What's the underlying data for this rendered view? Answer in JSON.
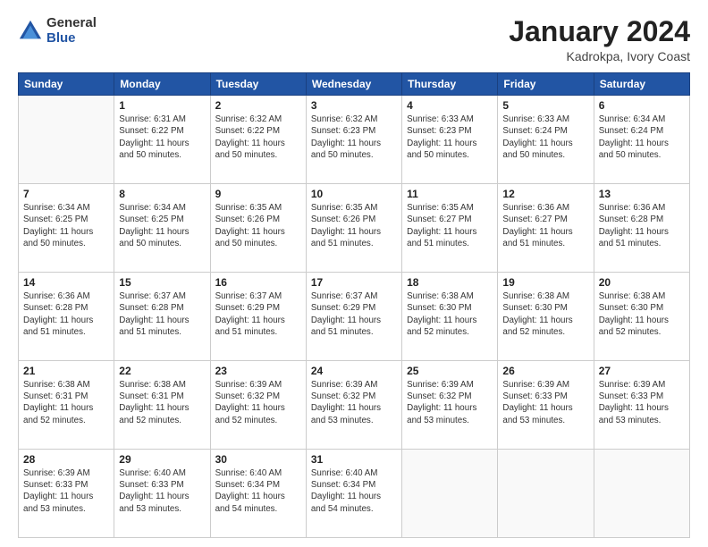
{
  "logo": {
    "general": "General",
    "blue": "Blue"
  },
  "header": {
    "month_year": "January 2024",
    "location": "Kadrokpa, Ivory Coast"
  },
  "days_of_week": [
    "Sunday",
    "Monday",
    "Tuesday",
    "Wednesday",
    "Thursday",
    "Friday",
    "Saturday"
  ],
  "weeks": [
    [
      {
        "day": "",
        "info": ""
      },
      {
        "day": "1",
        "info": "Sunrise: 6:31 AM\nSunset: 6:22 PM\nDaylight: 11 hours\nand 50 minutes."
      },
      {
        "day": "2",
        "info": "Sunrise: 6:32 AM\nSunset: 6:22 PM\nDaylight: 11 hours\nand 50 minutes."
      },
      {
        "day": "3",
        "info": "Sunrise: 6:32 AM\nSunset: 6:23 PM\nDaylight: 11 hours\nand 50 minutes."
      },
      {
        "day": "4",
        "info": "Sunrise: 6:33 AM\nSunset: 6:23 PM\nDaylight: 11 hours\nand 50 minutes."
      },
      {
        "day": "5",
        "info": "Sunrise: 6:33 AM\nSunset: 6:24 PM\nDaylight: 11 hours\nand 50 minutes."
      },
      {
        "day": "6",
        "info": "Sunrise: 6:34 AM\nSunset: 6:24 PM\nDaylight: 11 hours\nand 50 minutes."
      }
    ],
    [
      {
        "day": "7",
        "info": "Sunrise: 6:34 AM\nSunset: 6:25 PM\nDaylight: 11 hours\nand 50 minutes."
      },
      {
        "day": "8",
        "info": "Sunrise: 6:34 AM\nSunset: 6:25 PM\nDaylight: 11 hours\nand 50 minutes."
      },
      {
        "day": "9",
        "info": "Sunrise: 6:35 AM\nSunset: 6:26 PM\nDaylight: 11 hours\nand 50 minutes."
      },
      {
        "day": "10",
        "info": "Sunrise: 6:35 AM\nSunset: 6:26 PM\nDaylight: 11 hours\nand 51 minutes."
      },
      {
        "day": "11",
        "info": "Sunrise: 6:35 AM\nSunset: 6:27 PM\nDaylight: 11 hours\nand 51 minutes."
      },
      {
        "day": "12",
        "info": "Sunrise: 6:36 AM\nSunset: 6:27 PM\nDaylight: 11 hours\nand 51 minutes."
      },
      {
        "day": "13",
        "info": "Sunrise: 6:36 AM\nSunset: 6:28 PM\nDaylight: 11 hours\nand 51 minutes."
      }
    ],
    [
      {
        "day": "14",
        "info": "Sunrise: 6:36 AM\nSunset: 6:28 PM\nDaylight: 11 hours\nand 51 minutes."
      },
      {
        "day": "15",
        "info": "Sunrise: 6:37 AM\nSunset: 6:28 PM\nDaylight: 11 hours\nand 51 minutes."
      },
      {
        "day": "16",
        "info": "Sunrise: 6:37 AM\nSunset: 6:29 PM\nDaylight: 11 hours\nand 51 minutes."
      },
      {
        "day": "17",
        "info": "Sunrise: 6:37 AM\nSunset: 6:29 PM\nDaylight: 11 hours\nand 51 minutes."
      },
      {
        "day": "18",
        "info": "Sunrise: 6:38 AM\nSunset: 6:30 PM\nDaylight: 11 hours\nand 52 minutes."
      },
      {
        "day": "19",
        "info": "Sunrise: 6:38 AM\nSunset: 6:30 PM\nDaylight: 11 hours\nand 52 minutes."
      },
      {
        "day": "20",
        "info": "Sunrise: 6:38 AM\nSunset: 6:30 PM\nDaylight: 11 hours\nand 52 minutes."
      }
    ],
    [
      {
        "day": "21",
        "info": "Sunrise: 6:38 AM\nSunset: 6:31 PM\nDaylight: 11 hours\nand 52 minutes."
      },
      {
        "day": "22",
        "info": "Sunrise: 6:38 AM\nSunset: 6:31 PM\nDaylight: 11 hours\nand 52 minutes."
      },
      {
        "day": "23",
        "info": "Sunrise: 6:39 AM\nSunset: 6:32 PM\nDaylight: 11 hours\nand 52 minutes."
      },
      {
        "day": "24",
        "info": "Sunrise: 6:39 AM\nSunset: 6:32 PM\nDaylight: 11 hours\nand 53 minutes."
      },
      {
        "day": "25",
        "info": "Sunrise: 6:39 AM\nSunset: 6:32 PM\nDaylight: 11 hours\nand 53 minutes."
      },
      {
        "day": "26",
        "info": "Sunrise: 6:39 AM\nSunset: 6:33 PM\nDaylight: 11 hours\nand 53 minutes."
      },
      {
        "day": "27",
        "info": "Sunrise: 6:39 AM\nSunset: 6:33 PM\nDaylight: 11 hours\nand 53 minutes."
      }
    ],
    [
      {
        "day": "28",
        "info": "Sunrise: 6:39 AM\nSunset: 6:33 PM\nDaylight: 11 hours\nand 53 minutes."
      },
      {
        "day": "29",
        "info": "Sunrise: 6:40 AM\nSunset: 6:33 PM\nDaylight: 11 hours\nand 53 minutes."
      },
      {
        "day": "30",
        "info": "Sunrise: 6:40 AM\nSunset: 6:34 PM\nDaylight: 11 hours\nand 54 minutes."
      },
      {
        "day": "31",
        "info": "Sunrise: 6:40 AM\nSunset: 6:34 PM\nDaylight: 11 hours\nand 54 minutes."
      },
      {
        "day": "",
        "info": ""
      },
      {
        "day": "",
        "info": ""
      },
      {
        "day": "",
        "info": ""
      }
    ]
  ]
}
